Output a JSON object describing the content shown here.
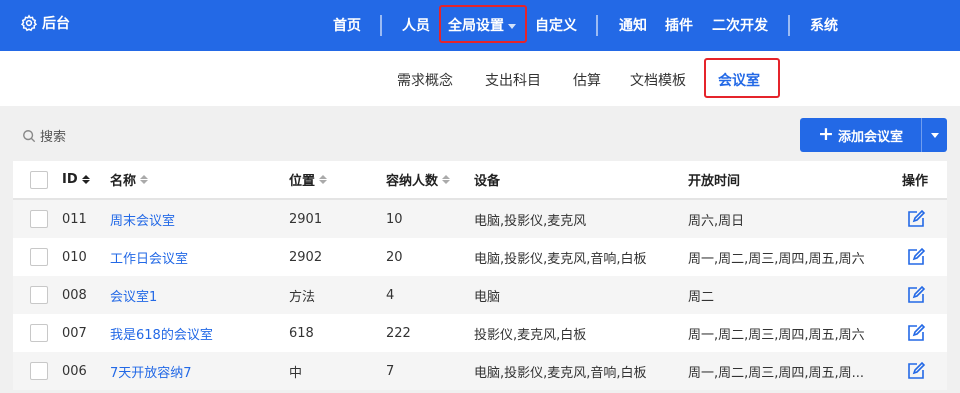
{
  "brand": {
    "label": "后台"
  },
  "top_nav": {
    "items": [
      {
        "label": "首页"
      },
      {
        "label": "人员"
      },
      {
        "label": "全局设置"
      },
      {
        "label": "自定义"
      },
      {
        "label": "通知"
      },
      {
        "label": "插件"
      },
      {
        "label": "二次开发"
      },
      {
        "label": "系统"
      }
    ],
    "active": "全局设置"
  },
  "sub_nav": {
    "items": [
      {
        "label": "需求概念"
      },
      {
        "label": "支出科目"
      },
      {
        "label": "估算"
      },
      {
        "label": "文档模板"
      },
      {
        "label": "会议室"
      }
    ],
    "active": "会议室"
  },
  "toolbar": {
    "search_label": "搜索",
    "add_label": "添加会议室"
  },
  "table": {
    "headers": {
      "id": "ID",
      "name": "名称",
      "location": "位置",
      "capacity": "容纳人数",
      "equipment": "设备",
      "open_time": "开放时间",
      "actions": "操作"
    },
    "rows": [
      {
        "id": "011",
        "name": "周末会议室",
        "location": "2901",
        "capacity": "10",
        "equipment": "电脑,投影仪,麦克风",
        "open_time": "周六,周日"
      },
      {
        "id": "010",
        "name": "工作日会议室",
        "location": "2902",
        "capacity": "20",
        "equipment": "电脑,投影仪,麦克风,音响,白板",
        "open_time": "周一,周二,周三,周四,周五,周六"
      },
      {
        "id": "008",
        "name": "会议室1",
        "location": "方法",
        "capacity": "4",
        "equipment": "电脑",
        "open_time": "周二"
      },
      {
        "id": "007",
        "name": "我是618的会议室",
        "location": "618",
        "capacity": "222",
        "equipment": "投影仪,麦克风,白板",
        "open_time": "周一,周二,周三,周四,周五,周六"
      },
      {
        "id": "006",
        "name": "7天开放容纳7",
        "location": "中",
        "capacity": "7",
        "equipment": "电脑,投影仪,麦克风,音响,白板",
        "open_time": "周一,周二,周三,周四,周五,周..."
      }
    ]
  },
  "colors": {
    "primary": "#2369e6",
    "highlight_border": "#e5242b"
  }
}
